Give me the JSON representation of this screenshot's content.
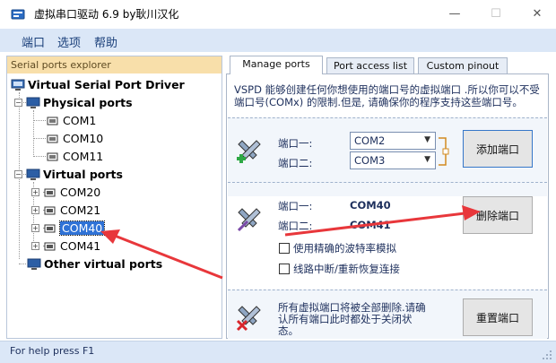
{
  "window": {
    "title": "虚拟串口驱动 6.9 by耿川汉化",
    "minimize_glyph": "—",
    "maximize_glyph": "☐",
    "close_glyph": "✕"
  },
  "menu": [
    "端口",
    "选项",
    "帮助"
  ],
  "explorer": {
    "header": "Serial ports explorer",
    "root": "Virtual Serial Port Driver",
    "physical": {
      "label": "Physical ports",
      "items": [
        "COM1",
        "COM10",
        "COM11"
      ]
    },
    "virtual": {
      "label": "Virtual ports",
      "items": [
        "COM20",
        "COM21",
        "COM40",
        "COM41"
      ],
      "selected": "COM40"
    },
    "other": "Other virtual ports"
  },
  "tabs": [
    "Manage ports",
    "Port access list",
    "Custom pinout"
  ],
  "manage": {
    "description": "VSPD 能够创建任何你想使用的端口号的虚拟端口 .所以你可以不受端口号(COMx) 的限制.但是, 请确保你的程序支持这些端口号。",
    "add": {
      "port1_label": "端口一:",
      "port2_label": "端口二:",
      "port1_value": "COM2",
      "port2_value": "COM3",
      "button": "添加端口"
    },
    "delete": {
      "port1_label": "端口一:",
      "port2_label": "端口二:",
      "port1_value": "COM40",
      "port2_value": "COM41",
      "button": "删除端口",
      "checkbox1": "使用精确的波特率模拟",
      "checkbox2": "线路中断/重新恢复连接"
    },
    "reset": {
      "text": "所有虚拟端口将被全部删除.请确认所有端口此时都处于关闭状态。",
      "button": "重置端口"
    }
  },
  "statusbar": {
    "text": "For help press F1"
  },
  "colors": {
    "menu_bg": "#dbe7f7",
    "explorer_header": "#f8dfaa",
    "selection": "#2f72d6",
    "annotation": "#e8373b"
  }
}
